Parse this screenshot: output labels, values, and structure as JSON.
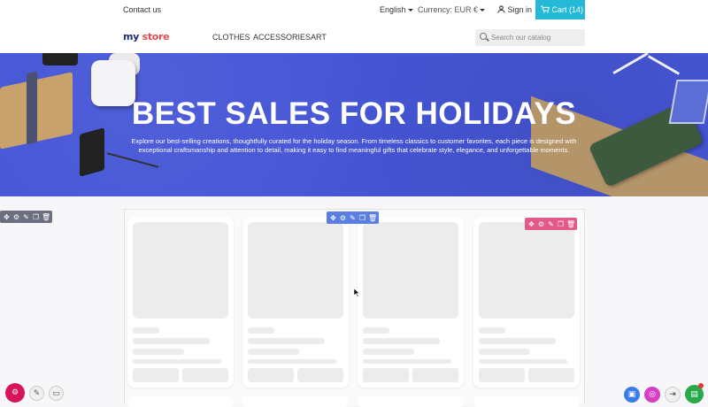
{
  "topbar": {
    "contact": "Contact us",
    "language": "English",
    "currency": "Currency: EUR €",
    "signin": "Sign in",
    "cart": "Cart (14)"
  },
  "header": {
    "logo_my": "my",
    "logo_store": "store",
    "nav": [
      "CLOTHES",
      "ACCESSORIES",
      "ART"
    ],
    "search_placeholder": "Search our catalog"
  },
  "hero": {
    "title": "BEST SALES FOR HOLIDAYS",
    "text": "Explore our best-selling creations, thoughtfully curated for the holiday season. From timeless classics to customer favorites, each piece is designed with exceptional craftsmanship and attention to detail, making it easy to find meaningful gifts that celebrate style, elegance, and unforgettable moments."
  },
  "toolbars": {
    "icons": [
      "move-icon",
      "settings-icon",
      "edit-icon",
      "duplicate-icon",
      "delete-icon"
    ],
    "colors": {
      "section": "#6b6f80",
      "block": "#5b7fe0",
      "widget": "#e35a8a"
    }
  },
  "fabs": {
    "icons": [
      "settings-icon",
      "edit-toggle-icon",
      "preview-desktop-icon",
      "save-draft-icon",
      "theme-icon",
      "exit-icon",
      "publish-icon"
    ]
  },
  "colors": {
    "cart_bg": "#24b9d7",
    "hero_bg": "#4656d6"
  }
}
